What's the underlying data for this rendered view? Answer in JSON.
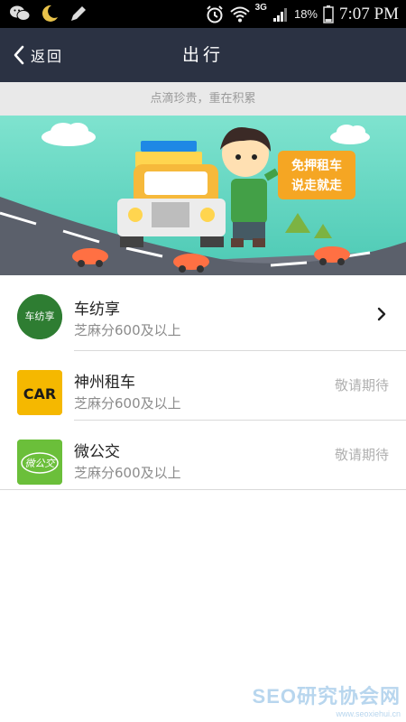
{
  "status_bar": {
    "time": "7:07 PM",
    "battery_percent": "18%",
    "network_type": "3G",
    "icons": [
      "wechat-icon",
      "moon-icon",
      "pen-icon",
      "alarm-icon",
      "wifi-icon",
      "signal-icon",
      "battery-icon"
    ]
  },
  "header": {
    "back_label": "返回",
    "title": "出行"
  },
  "slogan": "点滴珍贵，重在积累",
  "banner": {
    "promo_line1": "免押租车",
    "promo_line2": "说走就走"
  },
  "providers": [
    {
      "name": "车纺享",
      "requirement": "芝麻分600及以上",
      "status": "",
      "logo_text": "车纺享",
      "logo_color": "#2e7d32",
      "has_chevron": true
    },
    {
      "name": "神州租车",
      "requirement": "芝麻分600及以上",
      "status": "敬请期待",
      "logo_text": "CAR",
      "logo_color": "#f5b800",
      "has_chevron": false
    },
    {
      "name": "微公交",
      "requirement": "芝麻分600及以上",
      "status": "敬请期待",
      "logo_text": "微公交",
      "logo_color": "#6bbf3a",
      "has_chevron": false
    }
  ],
  "watermark": {
    "main": "SEO研究协会网",
    "sub": "www.seoxiehui.cn"
  },
  "colors": {
    "title_bar": "#2b3243",
    "slogan_bg": "#e9e9e9",
    "banner_sky": "#5fd6c0",
    "status_gray": "#b0b0b0"
  }
}
